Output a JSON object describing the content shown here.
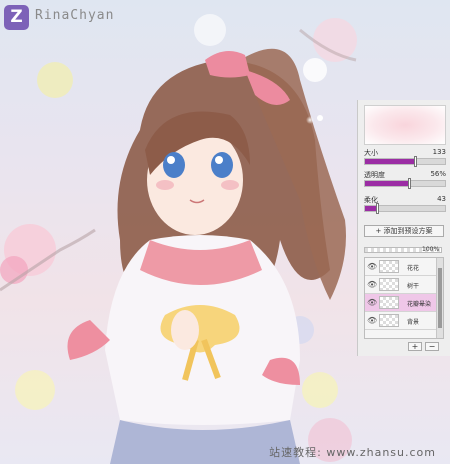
{
  "watermark": {
    "logo_letter": "Z",
    "author": "RinaChyan"
  },
  "credit": "站速教程: www.zhansu.com",
  "brush_panel": {
    "sliders": [
      {
        "label": "大小",
        "value": "133",
        "fill_fraction": 0.64
      },
      {
        "label": "透明度",
        "value": "56%",
        "fill_fraction": 0.56
      },
      {
        "label": "柔化",
        "value": "43",
        "fill_fraction": 0.16
      }
    ],
    "add_preset_label": "添加到预设方案",
    "add_preset_icon": "plus-icon",
    "opacity_value": "100%",
    "layers": [
      {
        "name": "花花",
        "selected": false,
        "icon": "eye-icon"
      },
      {
        "name": "树干",
        "selected": false,
        "icon": "eye-icon"
      },
      {
        "name": "花瓣晕染",
        "selected": true,
        "icon": "eye-icon"
      },
      {
        "name": "背景",
        "selected": false,
        "icon": "eye-icon"
      }
    ],
    "add_layer_label": "+",
    "remove_layer_label": "−"
  },
  "colors": {
    "accent": "#9b2da4",
    "selected_layer": "#efc7e8",
    "logo": "#7d62b8"
  }
}
